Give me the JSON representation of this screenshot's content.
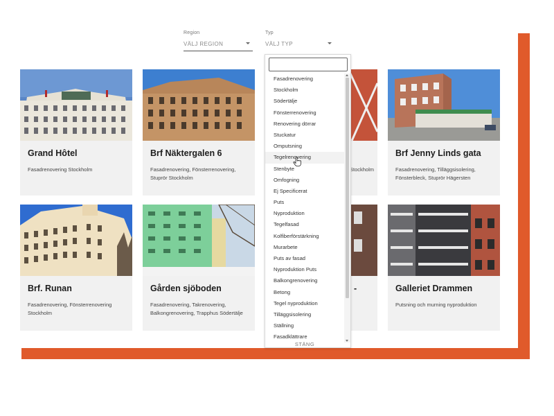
{
  "colors": {
    "accent_orange": "#e05a2b",
    "card_bg": "#f1f1f1"
  },
  "filters": {
    "region": {
      "label": "Region",
      "value": "VÄLJ REGION"
    },
    "type": {
      "label": "Typ",
      "value": "VÄLJ TYP"
    }
  },
  "cards": [
    {
      "title": "Grand Hôtel",
      "desc": "Fasadrenovering Stockholm",
      "image": "grand-hotel-photo"
    },
    {
      "title": "Brf Näktergalen 6",
      "desc": "Fasadrenovering, Fönsterrenovering, Stuprör Stockholm",
      "image": "brick-building-photo"
    },
    {
      "title": "",
      "desc": "Stockholm",
      "image": "hidden-card-photo"
    },
    {
      "title": "Brf Jenny Linds gata",
      "desc": "Fasadrenovering, Tilläggsisolering, Fönsterbleck, Stuprör Hägersten",
      "image": "jenny-linds-photo"
    },
    {
      "title": "Brf. Runan",
      "desc": "Fasadrenovering, Fönsterrenovering Stockholm",
      "image": "runan-photo"
    },
    {
      "title": "Gården sjöboden",
      "desc": "Fasadrenovering, Takrenovering, Balkongrenovering, Trapphus Södertälje",
      "image": "green-building-photo"
    },
    {
      "title": "-",
      "desc": "",
      "image": "hidden-card-photo-2"
    },
    {
      "title": "Galleriet Drammen",
      "desc": "Putsning och murning nyproduktion",
      "image": "galleriet-photo"
    }
  ],
  "dropdown": {
    "search_value": "",
    "items": [
      "Fasadrenovering",
      "Stockholm",
      "Södertälje",
      "Fönsterrenovering",
      "Renovering dörrar",
      "Stuckatur",
      "Omputsning",
      "Tegelrenovering",
      "Stenbyte",
      "Omfogning",
      "Ej Specificerat",
      "Puts",
      "Nyproduktion",
      "Tegelfasad",
      "Kolfiberförstärkning",
      "Murarbete",
      "Puts av fasad",
      "Nyproduktion Puts",
      "Balkongrenovering",
      "Betong",
      "Tegel nyproduktion",
      "Tilläggsisolering",
      "Ställning",
      "Fasadklättrare"
    ],
    "hover_index": 7,
    "close_label": "STÄNG"
  }
}
